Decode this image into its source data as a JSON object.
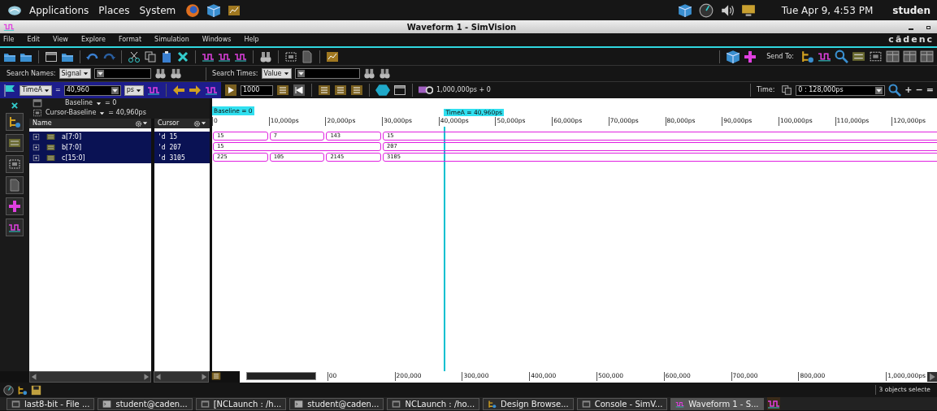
{
  "top_panel": {
    "menus": [
      "Applications",
      "Places",
      "System"
    ],
    "clock": "Tue Apr 9,  4:53 PM",
    "user": "studen"
  },
  "window": {
    "title": "Waveform 1 - SimVision",
    "brand": "cādenc"
  },
  "menu_bar": [
    "File",
    "Edit",
    "View",
    "Explore",
    "Format",
    "Simulation",
    "Windows",
    "Help"
  ],
  "toolbar": {
    "send_to_label": "Send To:"
  },
  "search_bar": {
    "names_label": "Search Names:",
    "names_mode": "Signal",
    "times_label": "Search Times:",
    "times_mode": "Value"
  },
  "time_bar": {
    "marker": "TimeA",
    "equals": "=",
    "marker_time": "40,960",
    "unit": "ps",
    "step": "1000",
    "end_time": "1,000,000ps + 0",
    "time_label": "Time:",
    "time_range": "0 : 128,000ps",
    "zoom_plus": "+",
    "zoom_minus": "−",
    "zoom_fit": "="
  },
  "markers": {
    "baseline": "Baseline",
    "baseline_value": "= 0",
    "delta": "Cursor-Baseline",
    "delta_value": "= 40,960ps"
  },
  "signal_list": {
    "columns": [
      "Name",
      "Cursor"
    ],
    "rows": [
      {
        "name": "a[7:0]",
        "cursor": "'d 15",
        "selected": true
      },
      {
        "name": "b[7:0]",
        "cursor": "'d 207",
        "selected": true
      },
      {
        "name": "c[15:0]",
        "cursor": "'d 3105",
        "selected": true
      }
    ]
  },
  "waveform": {
    "baseline_label": "Baseline = 0",
    "cursor_label": "TimeA = 40,960ps",
    "ticks": [
      "0",
      "10,000ps",
      "20,000ps",
      "30,000ps",
      "40,000ps",
      "50,000ps",
      "60,000ps",
      "70,000ps",
      "80,000ps",
      "90,000ps",
      "100,000ps",
      "110,000ps",
      "120,000ps"
    ],
    "signals": [
      {
        "slots": [
          {
            "kind": "change",
            "value": "15"
          },
          {
            "kind": "change",
            "value": "7"
          },
          {
            "kind": "change",
            "value": "143"
          },
          {
            "kind": "change",
            "value": "15"
          }
        ]
      },
      {
        "slots": [
          {
            "kind": "change",
            "value": "15"
          },
          {
            "kind": "hold"
          },
          {
            "kind": "hold"
          },
          {
            "kind": "change",
            "value": "207"
          }
        ]
      },
      {
        "slots": [
          {
            "kind": "change",
            "value": "225"
          },
          {
            "kind": "change",
            "value": "105"
          },
          {
            "kind": "change",
            "value": "2145"
          },
          {
            "kind": "change",
            "value": "3105"
          }
        ]
      }
    ]
  },
  "overview": {
    "ticks": [
      "00",
      "200,000",
      "300,000",
      "400,000",
      "500,000",
      "600,000",
      "700,000",
      "800,000",
      "1,000,000ps"
    ]
  },
  "status": "3 objects selecte",
  "taskbar": [
    {
      "label": "last8-bit - File ...",
      "selected": false
    },
    {
      "label": "student@caden...",
      "selected": false
    },
    {
      "label": "[NCLaunch : /h...",
      "selected": false
    },
    {
      "label": "student@caden...",
      "selected": false
    },
    {
      "label": "NCLaunch : /ho...",
      "selected": false
    },
    {
      "label": "Design Browse...",
      "selected": false
    },
    {
      "label": "Console - SimV...",
      "selected": false
    },
    {
      "label": "Waveform 1 - S...",
      "selected": true
    }
  ]
}
